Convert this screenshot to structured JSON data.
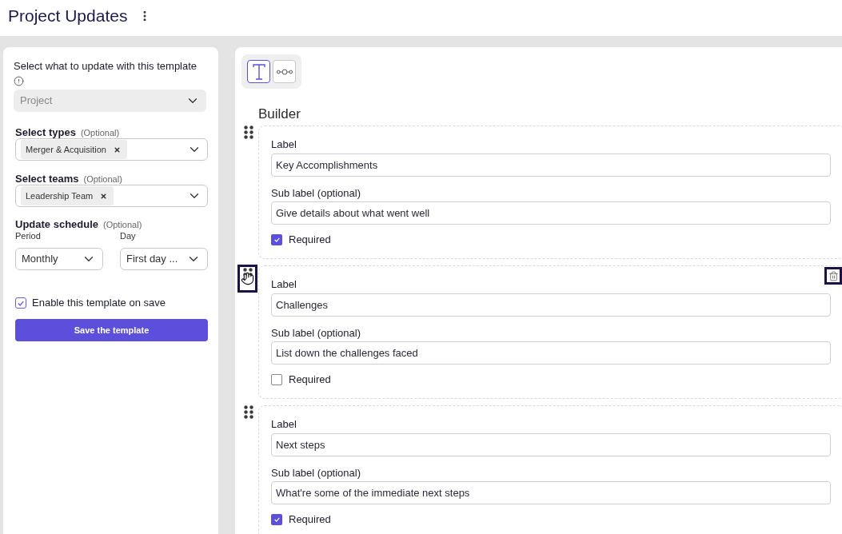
{
  "header": {
    "title": "Project Updates"
  },
  "settings": {
    "target": {
      "label": "Select what to update with this template",
      "value": "Project",
      "disabled": true
    },
    "types": {
      "label": "Select types",
      "optional": "(Optional)",
      "tags": [
        "Merger & Acquisition"
      ]
    },
    "teams": {
      "label": "Select teams",
      "optional": "(Optional)",
      "tags": [
        "Leadership Team"
      ]
    },
    "schedule": {
      "label": "Update schedule",
      "optional": "(Optional)",
      "period": {
        "label": "Period",
        "value": "Monthly"
      },
      "day": {
        "label": "Day",
        "value": "First day ..."
      }
    },
    "enable": {
      "label": "Enable this template on save",
      "checked": true
    },
    "save_button": "Save the template"
  },
  "builder": {
    "tools": [
      {
        "kind": "text",
        "selected": true
      },
      {
        "kind": "link",
        "selected": false
      }
    ],
    "title": "Builder",
    "fields": [
      {
        "label_caption": "Label",
        "label_value": "Key Accomplishments",
        "sublabel_caption": "Sub label (optional)",
        "sublabel_value": "Give details about what went well",
        "required_caption": "Required",
        "required": true,
        "hovered": false
      },
      {
        "label_caption": "Label",
        "label_value": "Challenges",
        "sublabel_caption": "Sub label (optional)",
        "sublabel_value": "List down the challenges faced",
        "required_caption": "Required",
        "required": false,
        "hovered": true
      },
      {
        "label_caption": "Label",
        "label_value": "Next steps",
        "sublabel_caption": "Sub label (optional)",
        "sublabel_value": "What're some of the immediate next steps",
        "required_caption": "Required",
        "required": true,
        "hovered": false
      }
    ]
  }
}
